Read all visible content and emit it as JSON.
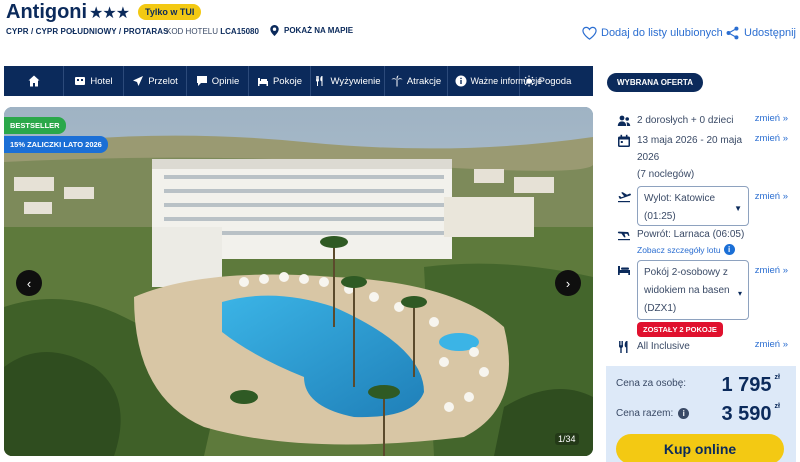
{
  "header": {
    "title": "Antigoni",
    "stars": "★★★",
    "badge": "Tylko w TUI",
    "location": "CYPR / CYPR POŁUDNIOWY / PROTARAS",
    "hotel_code_label": "KOD HOTELU",
    "hotel_code": "LCA15080",
    "map_link": "POKAŻ NA MAPIE",
    "favorites": "Dodaj do listy ulubionych",
    "share": "Udostępnij"
  },
  "nav": {
    "items": [
      {
        "label": "",
        "icon": "home-icon"
      },
      {
        "label": "Hotel",
        "icon": "hotel-icon"
      },
      {
        "label": "Przelot",
        "icon": "plane-icon"
      },
      {
        "label": "Opinie",
        "icon": "speech-bubble-icon"
      },
      {
        "label": "Pokoje",
        "icon": "bed-icon"
      },
      {
        "label": "Wyżywienie",
        "icon": "cutlery-icon"
      },
      {
        "label": "Atrakcje",
        "icon": "palm-icon"
      },
      {
        "label": "Ważne informacje",
        "icon": "info-icon"
      },
      {
        "label": "Pogoda",
        "icon": "sun-icon"
      }
    ]
  },
  "gallery": {
    "bestseller": "BESTSELLER",
    "promo": "15% ZALICZKI LATO 2026",
    "counter": "1/34",
    "prev": "‹",
    "next": "›"
  },
  "offer": {
    "title": "WYBRANA OFERTA",
    "guests": "2 dorosłych + 0 dzieci",
    "dates": "13 maja 2026 - 20 maja 2026",
    "nights": "(7 noclegów)",
    "departure": "Wylot: Katowice (01:25)",
    "return": "Powrót: Larnaca (06:05)",
    "flight_details": "Zobacz szczegóły lotu",
    "room": "Pokój 2-osobowy z widokiem na basen (DZX1)",
    "rooms_left": "ZOSTAŁY 2 POKOJE",
    "board": "All Inclusive",
    "change": "zmień »"
  },
  "price": {
    "per_person_label": "Cena za osobę:",
    "per_person": "1 795",
    "total_label": "Cena razem:",
    "total": "3 590",
    "currency": "zł",
    "buy": "Kup online"
  },
  "colors": {
    "navy": "#0b2a5b",
    "accent_yellow": "#f3c913",
    "link_blue": "#2b6ed1",
    "bestseller_green": "#2aa84a",
    "alert_red": "#e0112e",
    "price_bg": "#dde9f8"
  }
}
